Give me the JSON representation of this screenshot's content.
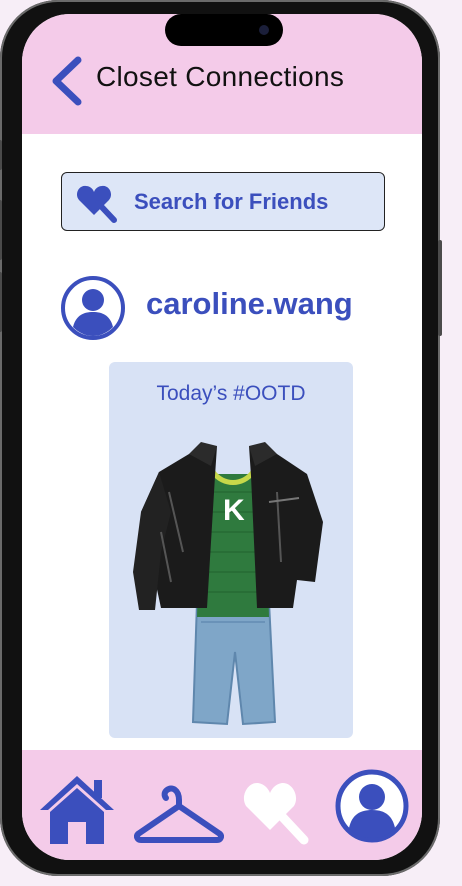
{
  "header": {
    "title": "Closet Connections"
  },
  "search": {
    "label": "Search for Friends"
  },
  "profile": {
    "username": "caroline.wang"
  },
  "ootd": {
    "title": "Today’s #OOTD",
    "letter": "K"
  },
  "nav": {
    "items": [
      "home-icon",
      "hanger-icon",
      "friends-icon",
      "profile-icon"
    ]
  },
  "colors": {
    "accent": "#3b4fbd",
    "header_bg": "#f4cbe9",
    "card_bg": "#d8e2f5"
  }
}
